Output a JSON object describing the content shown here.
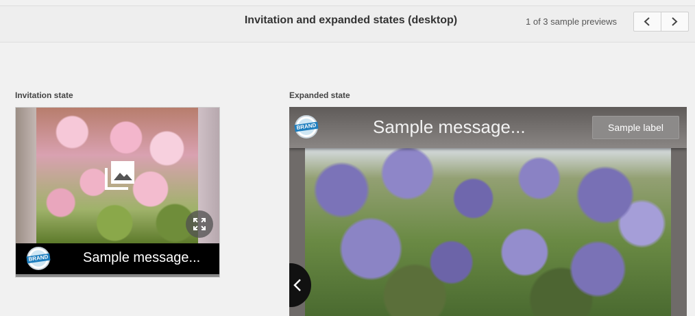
{
  "header": {
    "title": "Invitation and expanded states (desktop)",
    "counter": "1 of 3 sample previews"
  },
  "icons": {
    "prev": "chevron-left-icon",
    "next": "chevron-right-icon",
    "expand": "expand-icon",
    "image": "image-icon",
    "brand": "brand-logo"
  },
  "invitation": {
    "label": "Invitation state",
    "brand": "BRAND",
    "message": "Sample message..."
  },
  "expanded": {
    "label": "Expanded state",
    "brand": "BRAND",
    "message": "Sample message...",
    "button_label": "Sample label"
  }
}
